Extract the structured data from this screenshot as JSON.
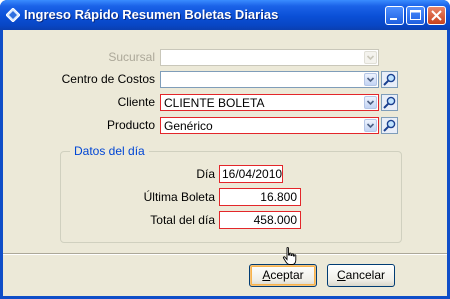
{
  "window": {
    "title": "Ingreso Rápido Resumen Boletas Diarias",
    "icon": "diamond-app-icon"
  },
  "form": {
    "sucursal": {
      "label": "Sucursal",
      "value": "",
      "enabled": false
    },
    "centro_costos": {
      "label": "Centro de Costos",
      "value": ""
    },
    "cliente": {
      "label": "Cliente",
      "value": "CLIENTE BOLETA"
    },
    "producto": {
      "label": "Producto",
      "value": "Genérico"
    }
  },
  "datos_del_dia": {
    "title": "Datos del día",
    "dia": {
      "label": "Día",
      "value": "16/04/2010"
    },
    "ultima_boleta": {
      "label": "Última Boleta",
      "value": "16.800"
    },
    "total_dia": {
      "label": "Total del día",
      "value": "458.000"
    }
  },
  "buttons": {
    "accept": {
      "mnemonic": "A",
      "rest": "ceptar"
    },
    "cancel": {
      "mnemonic": "C",
      "rest": "ancelar"
    }
  },
  "colors": {
    "titlebar": "#0a4fd6",
    "dialog_background": "#ece9d8",
    "required_border": "#e3262a",
    "group_title": "#0046d5"
  }
}
